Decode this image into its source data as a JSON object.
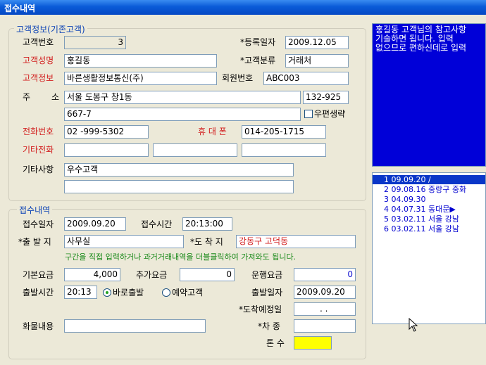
{
  "window": {
    "title": "접수내역"
  },
  "customer_info": {
    "legend": "고객정보(기존고객)",
    "customer_no_label": "고객번호",
    "customer_no": "3",
    "reg_date_label": "*등록일자",
    "reg_date": "2009.12.05",
    "name_label": "고객성명",
    "name": "홍길동",
    "category_label": "*고객분류",
    "category": "거래처",
    "info_label": "고객정보",
    "info": "바른생활정보통신(주)",
    "member_no_label": "회원번호",
    "member_no": "ABC003",
    "address_label_1": "주",
    "address_label_2": "소",
    "address1": "서울 도봉구 창1동",
    "postcode": "132-925",
    "address2": "667-7",
    "postal_omit_label": "우편생략",
    "phone_label": "전화번호",
    "phone": "02  -999-5302",
    "mobile_label": "휴 대 폰",
    "mobile": "014-205-1715",
    "other_phone_label": "기타전화",
    "other_phone1": "",
    "other_phone2": "",
    "other_phone3": "",
    "notes_label": "기타사항",
    "notes1": "우수고객",
    "notes2": ""
  },
  "reception": {
    "legend": "접수내역",
    "date_label": "접수일자",
    "date": "2009.09.20",
    "time_label": "접수시간",
    "time": "20:13:00",
    "origin_label": "*출 발 지",
    "origin": "사무실",
    "destination_label": "*도 착 지",
    "destination": "강동구 고덕동",
    "hint": "구간을 직접 입력하거나 과거거래내역을 더블클릭하여 가져와도 됩니다.",
    "base_fee_label": "기본요금",
    "base_fee": "4,000",
    "extra_fee_label": "추가요금",
    "extra_fee": "0",
    "fare_label": "운행요금",
    "fare": "0",
    "depart_time_label": "출발시간",
    "depart_time": "20:13",
    "radio_immediate": "바로출발",
    "radio_reserve": "예약고객",
    "depart_date_label": "출발일자",
    "depart_date": "2009.09.20",
    "arrival_date_label": "*도착예정일",
    "arrival_date": ".  .",
    "cargo_label": "화물내용",
    "cargo": "",
    "vehicle_label": "*차 종",
    "vehicle": "",
    "tonnage_label": "톤 수",
    "tonnage": ""
  },
  "memo": {
    "lines": [
      "홍길동 고객님의 참고사항",
      "기술하면 됩니다.  입력",
      "없으므로 편하신데로 입력"
    ]
  },
  "history": {
    "rows": [
      "1 09.09.20           /",
      "2 09.08.16 중랑구 중화",
      "3 04.09.30",
      "4 04.07.31    동대문▶",
      "5 03.02.11    서울 강남",
      "6 03.02.11    서울 강남"
    ]
  },
  "colors": {
    "title_bar": "#0a5bd8",
    "memo_bg": "#0000d8",
    "required_label": "#d21e1e",
    "legend_text": "#0b42b5",
    "hint_text": "#1b8a1b"
  }
}
